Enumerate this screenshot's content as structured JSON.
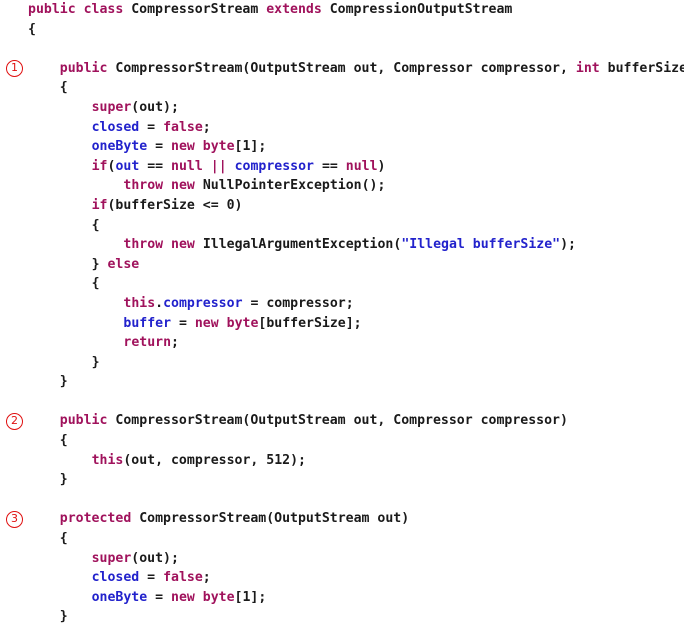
{
  "listing": {
    "language": "java",
    "class_name": "CompressorStream",
    "superclass": "CompressionOutputStream",
    "background_color": "#ffffff",
    "keyword_color": "#a0125c",
    "identifier_color": "#2222cc",
    "string_color": "#2222cc",
    "plain_color": "#1a1a1a",
    "marker_color": "#e01010",
    "markers": [
      {
        "label": "1",
        "line_index": 3
      },
      {
        "label": "2",
        "line_index": 18
      },
      {
        "label": "3",
        "line_index": 22
      }
    ],
    "lines": [
      {
        "index": 0,
        "indent": 0,
        "tokens": [
          {
            "t": "public",
            "c": "kw"
          },
          {
            "t": " ",
            "c": "pln"
          },
          {
            "t": "class",
            "c": "kw"
          },
          {
            "t": " CompressorStream ",
            "c": "pln"
          },
          {
            "t": "extends",
            "c": "kw"
          },
          {
            "t": " CompressionOutputStream",
            "c": "pln"
          }
        ]
      },
      {
        "index": 1,
        "indent": 0,
        "tokens": [
          {
            "t": "{",
            "c": "pln"
          }
        ]
      },
      {
        "index": 2,
        "indent": 0,
        "tokens": [
          {
            "t": "",
            "c": "pln"
          }
        ]
      },
      {
        "index": 3,
        "indent": 2,
        "tokens": [
          {
            "t": "public",
            "c": "kw"
          },
          {
            "t": " CompressorStream(OutputStream out, Compressor compressor, ",
            "c": "pln"
          },
          {
            "t": "int",
            "c": "kw"
          },
          {
            "t": " bufferSize)",
            "c": "pln"
          }
        ]
      },
      {
        "index": 4,
        "indent": 2,
        "tokens": [
          {
            "t": "{",
            "c": "pln"
          }
        ]
      },
      {
        "index": 5,
        "indent": 4,
        "tokens": [
          {
            "t": "super",
            "c": "kw"
          },
          {
            "t": "(out);",
            "c": "pln"
          }
        ]
      },
      {
        "index": 6,
        "indent": 4,
        "tokens": [
          {
            "t": "closed",
            "c": "fld"
          },
          {
            "t": " = ",
            "c": "pln"
          },
          {
            "t": "false",
            "c": "kw"
          },
          {
            "t": ";",
            "c": "pln"
          }
        ]
      },
      {
        "index": 7,
        "indent": 4,
        "tokens": [
          {
            "t": "oneByte",
            "c": "fld"
          },
          {
            "t": " = ",
            "c": "pln"
          },
          {
            "t": "new",
            "c": "kw"
          },
          {
            "t": " ",
            "c": "pln"
          },
          {
            "t": "byte",
            "c": "kw"
          },
          {
            "t": "[1];",
            "c": "pln"
          }
        ]
      },
      {
        "index": 8,
        "indent": 4,
        "tokens": [
          {
            "t": "if",
            "c": "kw"
          },
          {
            "t": "(",
            "c": "pln"
          },
          {
            "t": "out",
            "c": "fld"
          },
          {
            "t": " == ",
            "c": "pln"
          },
          {
            "t": "null",
            "c": "kw"
          },
          {
            "t": " ",
            "c": "pln"
          },
          {
            "t": "||",
            "c": "kw"
          },
          {
            "t": " ",
            "c": "pln"
          },
          {
            "t": "compressor",
            "c": "fld"
          },
          {
            "t": " == ",
            "c": "pln"
          },
          {
            "t": "null",
            "c": "kw"
          },
          {
            "t": ")",
            "c": "pln"
          }
        ]
      },
      {
        "index": 9,
        "indent": 6,
        "tokens": [
          {
            "t": "throw",
            "c": "kw"
          },
          {
            "t": " ",
            "c": "pln"
          },
          {
            "t": "new",
            "c": "kw"
          },
          {
            "t": " NullPointerException();",
            "c": "pln"
          }
        ]
      },
      {
        "index": 10,
        "indent": 4,
        "tokens": [
          {
            "t": "if",
            "c": "kw"
          },
          {
            "t": "(bufferSize <= 0)",
            "c": "pln"
          }
        ]
      },
      {
        "index": 11,
        "indent": 4,
        "tokens": [
          {
            "t": "{",
            "c": "pln"
          }
        ]
      },
      {
        "index": 12,
        "indent": 6,
        "tokens": [
          {
            "t": "throw",
            "c": "kw"
          },
          {
            "t": " ",
            "c": "pln"
          },
          {
            "t": "new",
            "c": "kw"
          },
          {
            "t": " IllegalArgumentException(",
            "c": "pln"
          },
          {
            "t": "\"Illegal bufferSize\"",
            "c": "str"
          },
          {
            "t": ");",
            "c": "pln"
          }
        ]
      },
      {
        "index": 13,
        "indent": 4,
        "tokens": [
          {
            "t": "} ",
            "c": "pln"
          },
          {
            "t": "else",
            "c": "kw"
          }
        ]
      },
      {
        "index": 14,
        "indent": 4,
        "tokens": [
          {
            "t": "{",
            "c": "pln"
          }
        ]
      },
      {
        "index": 15,
        "indent": 6,
        "tokens": [
          {
            "t": "this",
            "c": "kw"
          },
          {
            "t": ".",
            "c": "pln"
          },
          {
            "t": "compressor",
            "c": "fld"
          },
          {
            "t": " = compressor;",
            "c": "pln"
          }
        ]
      },
      {
        "index": 16,
        "indent": 6,
        "tokens": [
          {
            "t": "buffer",
            "c": "fld"
          },
          {
            "t": " = ",
            "c": "pln"
          },
          {
            "t": "new",
            "c": "kw"
          },
          {
            "t": " ",
            "c": "pln"
          },
          {
            "t": "byte",
            "c": "kw"
          },
          {
            "t": "[bufferSize];",
            "c": "pln"
          }
        ]
      },
      {
        "index": 17,
        "indent": 6,
        "tokens": [
          {
            "t": "return",
            "c": "kw"
          },
          {
            "t": ";",
            "c": "pln"
          }
        ]
      },
      {
        "index": 18,
        "indent": 4,
        "tokens": [
          {
            "t": "}",
            "c": "pln"
          }
        ]
      },
      {
        "index": 19,
        "indent": 2,
        "tokens": [
          {
            "t": "}",
            "c": "pln"
          }
        ]
      },
      {
        "index": 20,
        "indent": 0,
        "tokens": [
          {
            "t": "",
            "c": "pln"
          }
        ]
      },
      {
        "index": 21,
        "indent": 2,
        "tokens": [
          {
            "t": "public",
            "c": "kw"
          },
          {
            "t": " CompressorStream(OutputStream out, Compressor compressor)",
            "c": "pln"
          }
        ]
      },
      {
        "index": 22,
        "indent": 2,
        "tokens": [
          {
            "t": "{",
            "c": "pln"
          }
        ]
      },
      {
        "index": 23,
        "indent": 4,
        "tokens": [
          {
            "t": "this",
            "c": "kw"
          },
          {
            "t": "(out, compressor, 512);",
            "c": "pln"
          }
        ]
      },
      {
        "index": 24,
        "indent": 2,
        "tokens": [
          {
            "t": "}",
            "c": "pln"
          }
        ]
      },
      {
        "index": 25,
        "indent": 0,
        "tokens": [
          {
            "t": "",
            "c": "pln"
          }
        ]
      },
      {
        "index": 26,
        "indent": 2,
        "tokens": [
          {
            "t": "protected",
            "c": "kw"
          },
          {
            "t": " CompressorStream(OutputStream out)",
            "c": "pln"
          }
        ]
      },
      {
        "index": 27,
        "indent": 2,
        "tokens": [
          {
            "t": "{",
            "c": "pln"
          }
        ]
      },
      {
        "index": 28,
        "indent": 4,
        "tokens": [
          {
            "t": "super",
            "c": "kw"
          },
          {
            "t": "(out);",
            "c": "pln"
          }
        ]
      },
      {
        "index": 29,
        "indent": 4,
        "tokens": [
          {
            "t": "closed",
            "c": "fld"
          },
          {
            "t": " = ",
            "c": "pln"
          },
          {
            "t": "false",
            "c": "kw"
          },
          {
            "t": ";",
            "c": "pln"
          }
        ]
      },
      {
        "index": 30,
        "indent": 4,
        "tokens": [
          {
            "t": "oneByte",
            "c": "fld"
          },
          {
            "t": " = ",
            "c": "pln"
          },
          {
            "t": "new",
            "c": "kw"
          },
          {
            "t": " ",
            "c": "pln"
          },
          {
            "t": "byte",
            "c": "kw"
          },
          {
            "t": "[1];",
            "c": "pln"
          }
        ]
      },
      {
        "index": 31,
        "indent": 2,
        "tokens": [
          {
            "t": "}",
            "c": "pln"
          }
        ]
      }
    ],
    "marker_rows": [
      {
        "label": "1",
        "row": 3
      },
      {
        "label": "2",
        "row": 21
      },
      {
        "label": "3",
        "row": 26
      }
    ]
  }
}
